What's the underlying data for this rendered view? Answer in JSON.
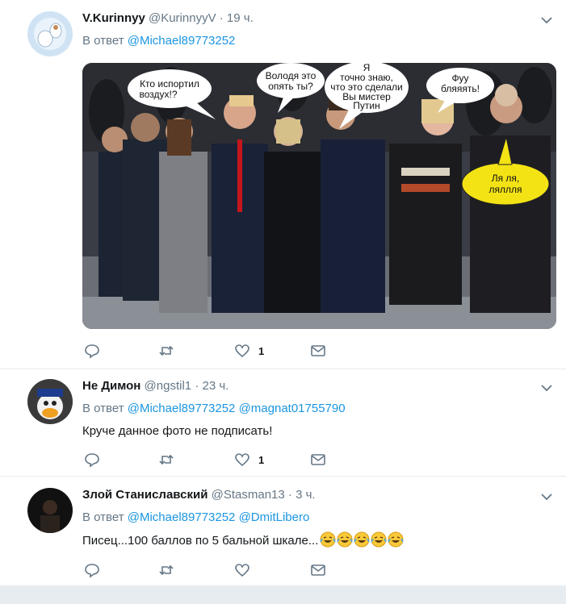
{
  "tweets": [
    {
      "name": "V.Kurinnyy",
      "handle": "@KurinnyyV",
      "time": "19 ч.",
      "reply_prefix": "В ответ",
      "mentions": [
        "@Michael89773252"
      ],
      "text": "",
      "likes": "1",
      "photo_bubbles": [
        "Кто испортил",
        "воздух!?",
        "Володя это",
        "опять ты?",
        "Я",
        "точно знаю,",
        "что это сделали",
        "Вы мистер",
        "Путин",
        "Фуу",
        "бляяять!",
        "Ля ля,",
        "ляллля"
      ]
    },
    {
      "name": "Не Димон",
      "handle": "@ngstil1",
      "time": "23 ч.",
      "reply_prefix": "В ответ",
      "mentions": [
        "@Michael89773252",
        "@magnat01755790"
      ],
      "text": "Круче данное фото не подписать!",
      "likes": "1"
    },
    {
      "name": "Злой Станиславский",
      "handle": "@Stasman13",
      "time": "3 ч.",
      "reply_prefix": "В ответ",
      "mentions": [
        "@Michael89773252",
        "@DmitLibero"
      ],
      "text": "Писец...100 баллов по 5 бальной шкале...",
      "likes": "",
      "emoji_count": 5
    }
  ],
  "icons": [
    "reply-icon",
    "retweet-icon",
    "like-icon",
    "direct-message-icon",
    "chevron-down-icon"
  ],
  "colors": {
    "link": "#1b95e0",
    "muted": "#657786",
    "divider": "#e6ecf0"
  }
}
